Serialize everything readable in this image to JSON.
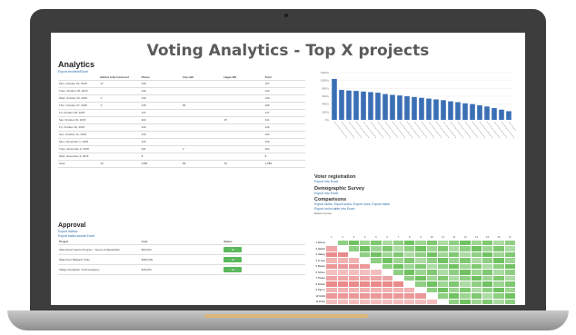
{
  "page_title": "Voting Analytics - Top X projects",
  "analytics": {
    "heading": "Analytics",
    "export_link": "Export text/text/Excel",
    "columns": [
      "",
      "Ballots fully traversed",
      "Phone",
      "City Hall",
      "Hagar MS",
      "Total"
    ],
    "rows": [
      [
        "Mon, October 24, 2015",
        "17",
        "135",
        "",
        "",
        "157"
      ],
      [
        "Tues, October 25, 2015",
        "",
        "132",
        "",
        "",
        "132"
      ],
      [
        "Wed, October 26, 2015",
        "1",
        "133",
        "",
        "",
        "133"
      ],
      [
        "Thur, October 27, 2015",
        "3",
        "135",
        "83",
        "",
        "206"
      ],
      [
        "Fri, October 28, 2015",
        "",
        "147",
        "",
        "",
        "147"
      ],
      [
        "Sat, October 29, 2015",
        "",
        "203",
        "",
        "15",
        "341"
      ],
      [
        "Fri, October 30, 2015",
        "",
        "119",
        "",
        "",
        "119"
      ],
      [
        "Sun, October 31, 2015",
        "",
        "133",
        "",
        "",
        "133"
      ],
      [
        "Mon, November 1, 2015",
        "",
        "119",
        "",
        "",
        "119"
      ],
      [
        "Tues, November 2, 2015",
        "",
        "401",
        "2",
        "",
        "402"
      ],
      [
        "Wed, November 3, 2015",
        "",
        "8",
        "",
        "",
        "8"
      ],
      [
        "Total",
        "43",
        "1365",
        "89",
        "15",
        "1,885"
      ]
    ]
  },
  "approval": {
    "heading": "Approval",
    "links": [
      "Export ballots",
      "Export ballot assets Excel"
    ],
    "columns": [
      "Project",
      "Cost",
      "Status"
    ],
    "rows": [
      [
        "Afterschool Sports Program - Soccer & Basketball",
        "$60,000",
        "ok"
      ],
      [
        "Waterfront Ballpark Trails",
        "$300,000",
        "ok"
      ],
      [
        "Vallejo Firefighter Youth Academy",
        "$15,000",
        "ok"
      ]
    ]
  },
  "chart_data": {
    "type": "bar",
    "title": "",
    "xlabel": "",
    "ylabel": "",
    "ylim": [
      0,
      1200
    ],
    "y_ticks": [
      "1200 k",
      "1000 k",
      "800 k",
      "600 k",
      "400 k",
      "200 k",
      "0 k"
    ],
    "categories": [
      "",
      "",
      "",
      "",
      "",
      "",
      "",
      "",
      "",
      "",
      "",
      "",
      "",
      "",
      "",
      "",
      "",
      "",
      "",
      "",
      "",
      "",
      "",
      "",
      ""
    ],
    "values": [
      1040,
      760,
      745,
      735,
      720,
      705,
      690,
      655,
      635,
      620,
      600,
      580,
      560,
      540,
      520,
      500,
      470,
      450,
      420,
      400,
      370,
      340,
      300,
      260,
      220
    ],
    "bar_color": "#3b6fb5"
  },
  "voter_registration": {
    "heading": "Voter registration",
    "link": "Export into Excel"
  },
  "demographic_survey": {
    "heading": "Demographic Survey",
    "link": "Export into Excel"
  },
  "comparisons": {
    "heading": "Comparisons",
    "link": "Export ranks, Export sums, Export rows, Export ratios",
    "link2": "Export union table into Excel",
    "legend": "Ratios  Counts",
    "header": [
      "",
      "1",
      "2",
      "3",
      "4",
      "5",
      "6",
      "7",
      "8",
      "9",
      "10",
      "11",
      "12",
      "13",
      "14",
      "15",
      "16",
      "17"
    ],
    "rows": [
      "1 Afterschool Sports Program - Soccer & Basketball",
      "2 Waterfront History Arts Park",
      "3 Vallejo Firefighter Youth Academy",
      "4 In Hoop Hangs Solar Kits - Afterschool Youth Program",
      "5 Beautify Downtown and Georgia Park",
      "6 School Route Repair",
      "7 Pedestrian Safety and Traffic Calming",
      "8 Enhanced Disaster Response",
      "9 Part A Vallejo & Forced Waterfront Promenade Ramp",
      "10 Mobile Dual Home Cooking Centre for Kids",
      "11 Enhance Neighborhood Watch - Outreach Van for VPD",
      "12 Better Streets - New Lanes & Markings"
    ],
    "green": "#6abf5a",
    "red": "#e87f7f"
  }
}
